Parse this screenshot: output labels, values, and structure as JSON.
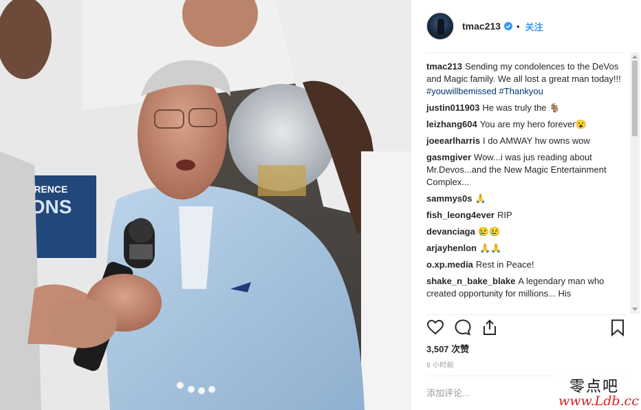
{
  "post": {
    "photo_alt": "",
    "banner_text": "ERENCE",
    "banner_text2": "IONS"
  },
  "header": {
    "username": "tmac213",
    "follow_label": "关注"
  },
  "comments": [
    {
      "user": "tmac213",
      "text": "Sending my condolences to the DeVos and Magic family. We all lost a great man today!!!",
      "hashtags": "#youwillbemissed #Thankyou"
    },
    {
      "user": "justin011903",
      "text": "He was truly the 🐐"
    },
    {
      "user": "leizhang604",
      "text": "You are my hero forever😮"
    },
    {
      "user": "joeearlharris",
      "text": "I do AMWAY hw owns wow"
    },
    {
      "user": "gasmgiver",
      "text": "Wow...i was jus reading about Mr.Devos...and the New Magic Entertainment Complex..."
    },
    {
      "user": "sammys0s",
      "text": "🙏"
    },
    {
      "user": "fish_leong4ever",
      "text": "RIP"
    },
    {
      "user": "devanciaga",
      "text": "😢😢"
    },
    {
      "user": "arjayhenlon",
      "text": "🙏🙏"
    },
    {
      "user": "o.xp.media",
      "text": "Rest in Peace!"
    },
    {
      "user": "shake_n_bake_blake",
      "text": "A legendary man who created opportunity for millions... His"
    }
  ],
  "actions": {
    "like_icon": "heart-icon",
    "comment_icon": "comment-bubble-icon",
    "share_icon": "share-icon",
    "save_icon": "bookmark-icon"
  },
  "likes": "3,507 次赞",
  "time": "9 小时前",
  "add_comment_placeholder": "添加评论...",
  "watermark": {
    "cn": "零点吧",
    "url": "www.Ldb.cc"
  },
  "colors": {
    "link_blue": "#3897f0",
    "hashtag": "#003569",
    "watermark_red": "#d81e1e"
  }
}
